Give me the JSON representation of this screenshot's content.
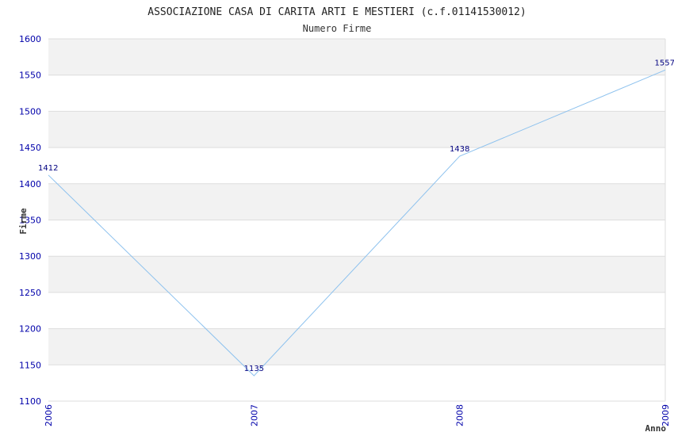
{
  "chart_data": {
    "type": "line",
    "title": "ASSOCIAZIONE CASA DI CARITA ARTI E MESTIERI (c.f.01141530012)",
    "subtitle": "Numero Firme",
    "xlabel": "Anno",
    "ylabel": "Firme",
    "x": [
      "2006",
      "2007",
      "2008",
      "2009"
    ],
    "series": [
      {
        "values": [
          1412,
          1135,
          1438,
          1557
        ]
      }
    ],
    "data_labels": [
      "1412",
      "1135",
      "1438",
      "1557"
    ],
    "ylim": [
      1100,
      1600
    ],
    "yticks": [
      1100,
      1150,
      1200,
      1250,
      1300,
      1350,
      1400,
      1450,
      1500,
      1550,
      1600
    ],
    "grid": true,
    "colors": {
      "line": "#8ec2ee",
      "band": "#f2f2f2",
      "grid": "#dddddd",
      "tick_text": "#0000aa",
      "label_text": "#000080",
      "title_text": "#222222",
      "axis_label_text": "#333333"
    }
  }
}
